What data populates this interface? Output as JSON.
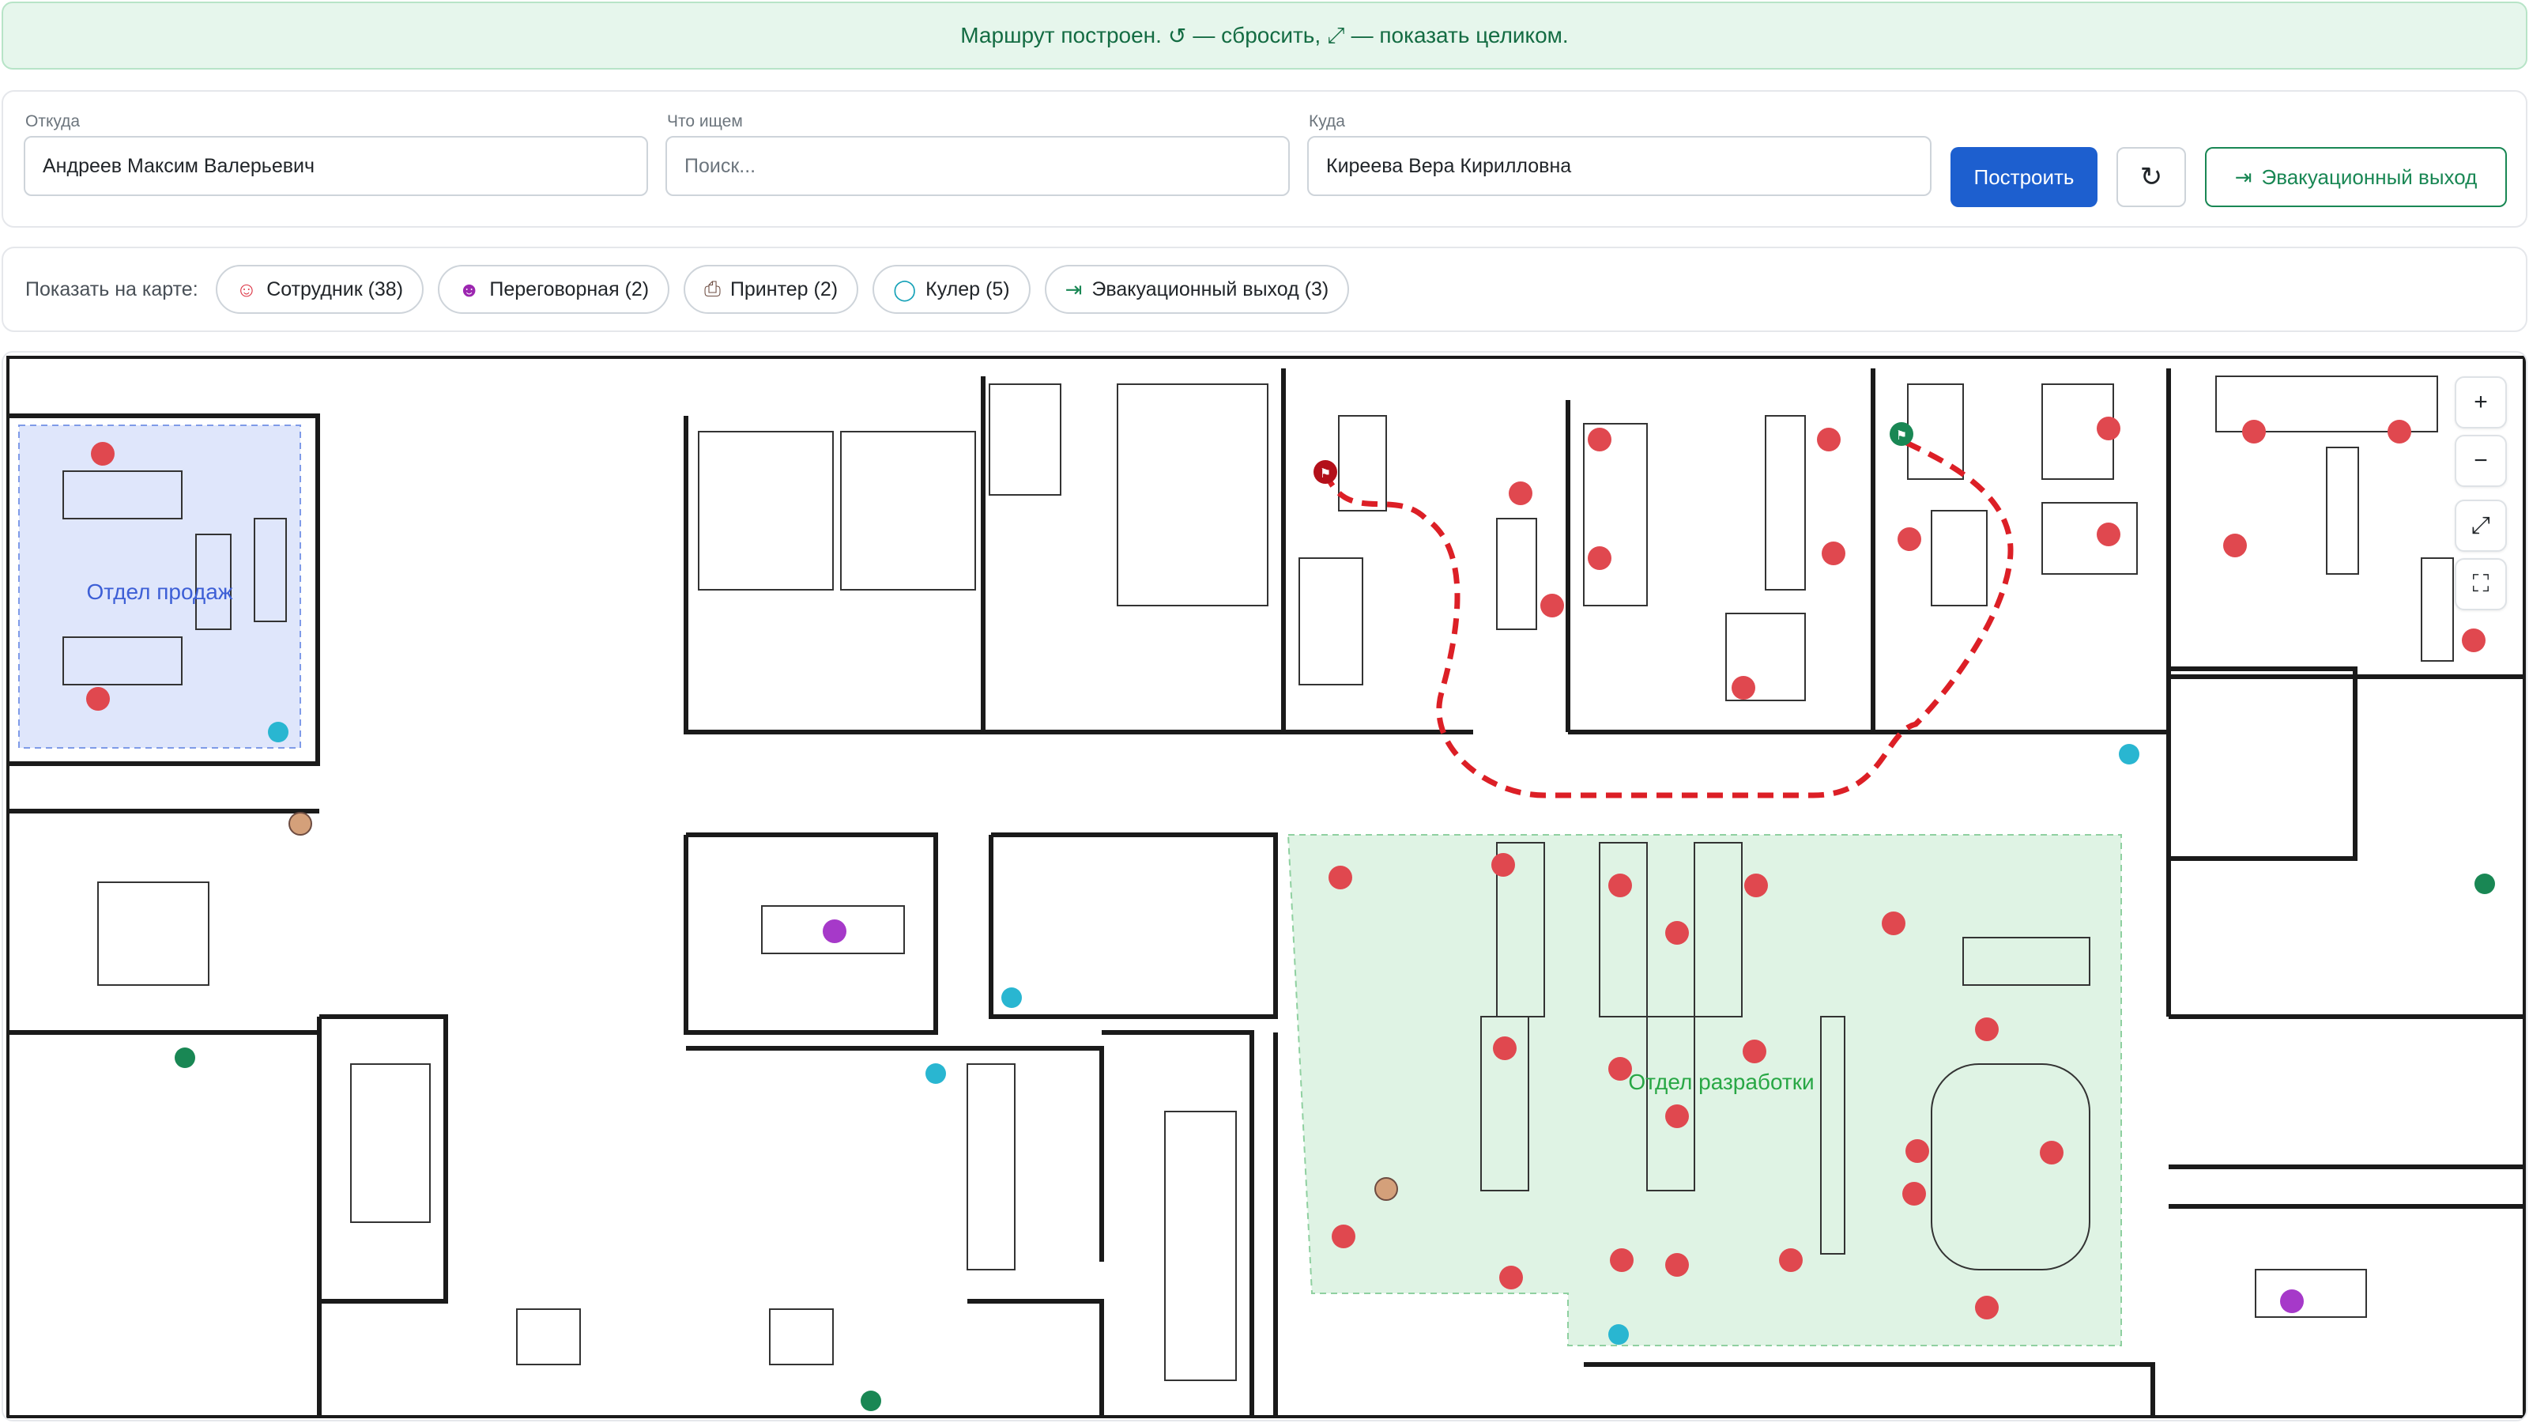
{
  "banner": {
    "text_before": "Маршрут построен.",
    "text_reset": "— сбросить,",
    "text_fit": "— показать целиком."
  },
  "search": {
    "from_label": "Откуда",
    "from_value": "Андреев Максим Валерьевич",
    "what_label": "Что ищем",
    "what_placeholder": "Поиск...",
    "to_label": "Куда",
    "to_value": "Киреева Вера Кирилловна",
    "build_button": "Построить",
    "evac_button": "Эвакуационный выход"
  },
  "filters": {
    "label": "Показать на карте:",
    "chips": [
      {
        "label": "Сотрудник (38)",
        "icon": "person-icon",
        "color": "#dc3545"
      },
      {
        "label": "Переговорная (2)",
        "icon": "people-icon",
        "color": "#9c27b0"
      },
      {
        "label": "Принтер (2)",
        "icon": "printer-icon",
        "color": "#6d4c41"
      },
      {
        "label": "Кулер (5)",
        "icon": "droplet-icon",
        "color": "#17a2b8"
      },
      {
        "label": "Эвакуационный выход (3)",
        "icon": "exit-icon",
        "color": "#198754"
      }
    ]
  },
  "map": {
    "zones": [
      {
        "label": "Отдел продаж",
        "color": "#3d5fd6",
        "fill": "#dfe6fb"
      },
      {
        "label": "Отдел разработки",
        "color": "#28a745",
        "fill": "#dff3e4"
      }
    ],
    "route_color": "#dc1f26",
    "zoom_controls": {
      "plus": "+",
      "minus": "−"
    }
  }
}
